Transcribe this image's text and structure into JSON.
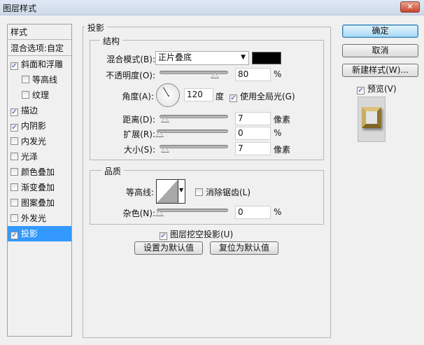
{
  "window": {
    "title": "图层样式",
    "close": "✕"
  },
  "sidebar": {
    "header": "样式",
    "blend_options": "混合选项:自定",
    "items": [
      {
        "label": "斜面和浮雕",
        "checked": true,
        "indent": false
      },
      {
        "label": "等高线",
        "checked": false,
        "indent": true
      },
      {
        "label": "纹理",
        "checked": false,
        "indent": true
      },
      {
        "label": "描边",
        "checked": true,
        "indent": false
      },
      {
        "label": "内阴影",
        "checked": true,
        "indent": false
      },
      {
        "label": "内发光",
        "checked": false,
        "indent": false
      },
      {
        "label": "光泽",
        "checked": false,
        "indent": false
      },
      {
        "label": "颜色叠加",
        "checked": false,
        "indent": false
      },
      {
        "label": "渐变叠加",
        "checked": false,
        "indent": false
      },
      {
        "label": "图案叠加",
        "checked": false,
        "indent": false
      },
      {
        "label": "外发光",
        "checked": false,
        "indent": false
      },
      {
        "label": "投影",
        "checked": true,
        "indent": false,
        "selected": true
      }
    ]
  },
  "main": {
    "title": "投影",
    "structure": {
      "title": "结构",
      "blend_mode_label": "混合模式(B):",
      "blend_mode": "正片叠底",
      "shadow_color": "#000000",
      "opacity_label": "不透明度(O):",
      "opacity": "80",
      "opacity_unit": "%",
      "angle_label": "角度(A):",
      "angle": "120",
      "angle_unit": "度",
      "global_light_label": "使用全局光(G)",
      "global_light": true,
      "distance_label": "距离(D):",
      "distance": "7",
      "distance_unit": "像素",
      "spread_label": "扩展(R):",
      "spread": "0",
      "spread_unit": "%",
      "size_label": "大小(S):",
      "size": "7",
      "size_unit": "像素"
    },
    "quality": {
      "title": "品质",
      "contour_label": "等高线:",
      "antialias_label": "消除锯齿(L)",
      "antialias": false,
      "noise_label": "杂色(N):",
      "noise": "0",
      "noise_unit": "%"
    },
    "knockout_label": "图层挖空投影(U)",
    "knockout": true,
    "set_default": "设置为默认值",
    "reset_default": "复位为默认值"
  },
  "actions": {
    "ok": "确定",
    "cancel": "取消",
    "new_style": "新建样式(W)...",
    "preview_label": "预览(V)",
    "preview": true
  }
}
